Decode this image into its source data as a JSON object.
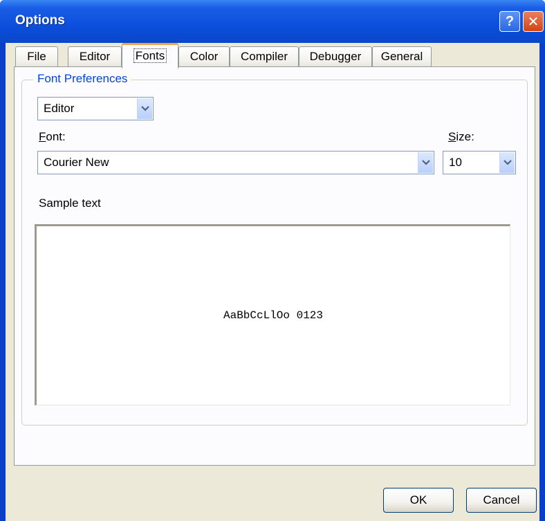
{
  "window": {
    "title": "Options",
    "help_glyph": "?",
    "close_glyph": "✕"
  },
  "tabs": [
    {
      "label": "File"
    },
    {
      "label": "Editor"
    },
    {
      "label": "Fonts",
      "active": true
    },
    {
      "label": "Color"
    },
    {
      "label": "Compiler"
    },
    {
      "label": "Debugger"
    },
    {
      "label": "General"
    }
  ],
  "font_prefs": {
    "group_label": "Font Preferences",
    "target_select": {
      "value": "Editor"
    },
    "font_label_hotkey": "F",
    "font_label_rest": "ont:",
    "font_select": {
      "value": "Courier New"
    },
    "size_label_hotkey": "S",
    "size_label_rest": "ize:",
    "size_select": {
      "value": "10"
    },
    "sample_label": "Sample text",
    "sample_text": "AaBbCcLlOo 0123"
  },
  "buttons": {
    "ok": "OK",
    "cancel": "Cancel"
  },
  "colors": {
    "titlebar": "#0b4fdc",
    "dialog_face": "#ece9d8",
    "group_label": "#0046d5",
    "active_tab_accent": "#f2a33a"
  },
  "icons": {
    "dropdown_arrow": "chevron-down-icon",
    "help": "help-icon",
    "close": "close-icon"
  }
}
